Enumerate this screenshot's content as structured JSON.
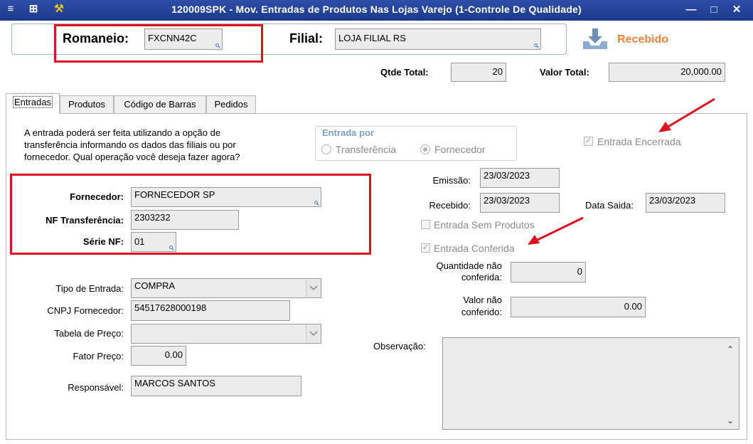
{
  "window": {
    "title": "120009SPK - Mov. Entradas de Produtos Nas Lojas Varejo (1-Controle De Qualidade)",
    "icons": [
      "menu-icon",
      "tree-icon",
      "wrench-icon"
    ],
    "controls": [
      "minimize-icon",
      "maximize-icon",
      "close-icon"
    ]
  },
  "header": {
    "romaneio_label": "Romaneio:",
    "romaneio_value": "FXCNN42C",
    "filial_label": "Filial:",
    "filial_value": "LOJA FILIAL RS",
    "status_label": "Recebido",
    "status_color": "#f5813d",
    "qtde_label": "Qtde Total:",
    "qtde_value": "20",
    "valor_label": "Valor Total:",
    "valor_value": "20,000.00"
  },
  "tabs": [
    {
      "label": "Entradas",
      "active": true
    },
    {
      "label": "Produtos",
      "active": false
    },
    {
      "label": "Código de Barras",
      "active": false
    },
    {
      "label": "Pedidos",
      "active": false
    }
  ],
  "entradas": {
    "info_text_1": "A entrada poderá ser feita utilizando a opção de",
    "info_text_2": "transferência informando os dados das filiais ou por",
    "info_text_3": "fornecedor. Qual operação você deseja fazer agora?",
    "entrada_por_label": "Entrada por",
    "opt_transferencia": "Transferência",
    "opt_fornecedor": "Fornecedor",
    "entrada_encerrada": "Entrada Encerrada",
    "fornecedor_label": "Fornecedor:",
    "fornecedor_value": "FORNECEDOR SP",
    "nf_label": "NF Transferência:",
    "nf_value": "2303232",
    "serie_label": "Série NF:",
    "serie_value": "01",
    "emissao_label": "Emissão:",
    "emissao_value": "23/03/2023",
    "recebido_label": "Recebido:",
    "recebido_value": "23/03/2023",
    "data_saida_label": "Data Saida:",
    "data_saida_value": "23/03/2023",
    "sem_produtos": "Entrada Sem Produtos",
    "conferida": "Entrada Conferida",
    "qtd_nao_conf_1": "Quantidade não",
    "qtd_nao_conf_2": "conferida:",
    "qtd_nao_conf_value": "0",
    "valor_nao_conf_1": "Valor não",
    "valor_nao_conf_2": "conferido:",
    "valor_nao_conf_value": "0.00",
    "tipo_label": "Tipo de Entrada:",
    "tipo_value": "COMPRA",
    "cnpj_label": "CNPJ Fornecedor:",
    "cnpj_value": "54517628000198",
    "tabela_label": "Tabela de Preço:",
    "tabela_value": "",
    "fator_label": "Fator Preço:",
    "fator_value": "0.00",
    "responsavel_label": "Responsável:",
    "responsavel_value": "MARCOS SANTOS",
    "observacao_label": "Observação:",
    "observacao_value": ""
  },
  "colors": {
    "titlebar": "#1c3a8a",
    "annotation_red": "#e0101e"
  }
}
